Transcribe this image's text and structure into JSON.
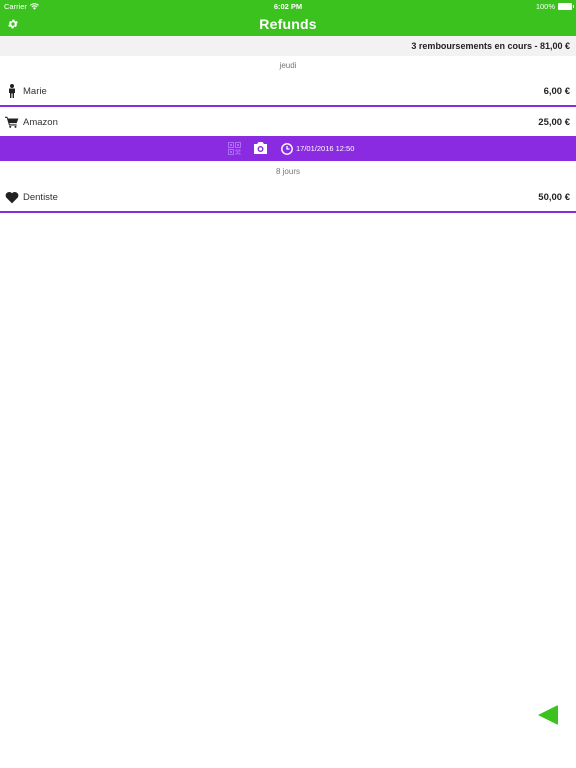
{
  "status_bar": {
    "carrier": "Carrier",
    "time": "6:02 PM",
    "battery": "100%"
  },
  "nav": {
    "title": "Refunds",
    "settings_icon": "gear-icon"
  },
  "summary": {
    "text": "3 remboursements en cours - 81,00 €"
  },
  "sections": [
    {
      "header": "jeudi",
      "items": [
        {
          "icon": "person-icon",
          "label": "Marie",
          "amount": "6,00 €"
        },
        {
          "icon": "cart-icon",
          "label": "Amazon",
          "amount": "25,00 €"
        }
      ]
    },
    {
      "header": "8 jours",
      "items": [
        {
          "icon": "heart-icon",
          "label": "Dentiste",
          "amount": "50,00 €"
        }
      ]
    }
  ],
  "action_bar": {
    "date": "17/01/2016 12:50",
    "icons": [
      "qr-code-icon",
      "camera-icon",
      "clock-icon"
    ]
  },
  "colors": {
    "primary_green": "#3cc21e",
    "accent_purple": "#8a2be2"
  },
  "back_button_icon": "triangle-left-icon"
}
